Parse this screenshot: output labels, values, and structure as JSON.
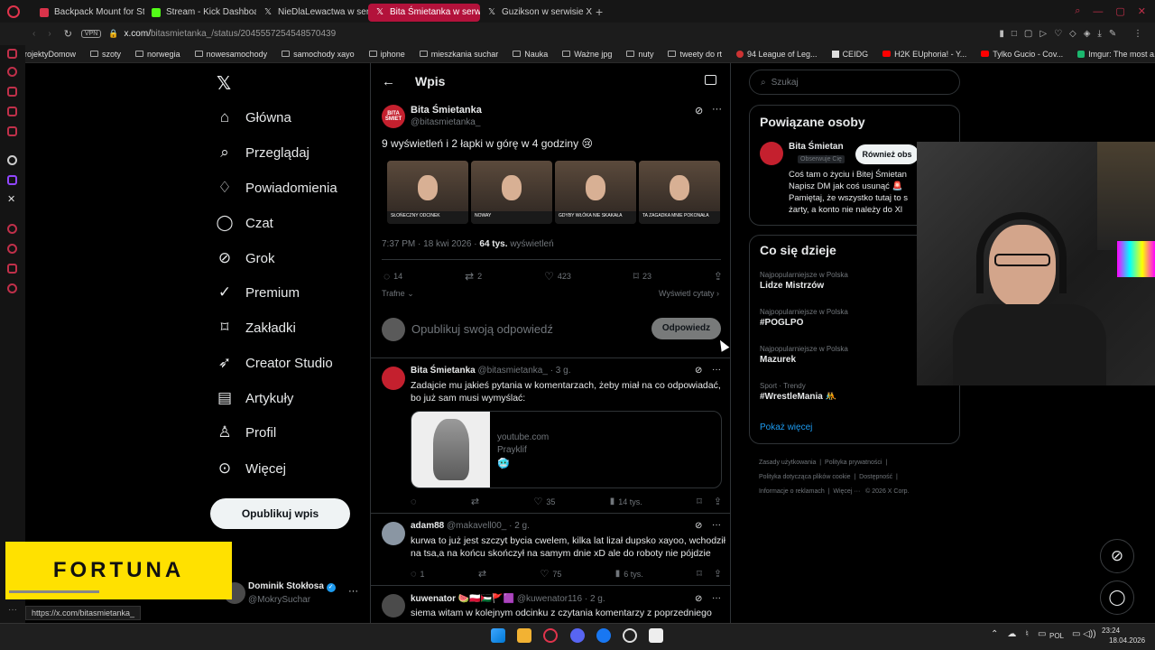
{
  "tabs": [
    {
      "label": "Backpack Mount for Starli",
      "icon": "red-icon"
    },
    {
      "label": "Stream - Kick Dashboard",
      "icon": "kick-icon"
    },
    {
      "label": "NieDlaLewactwa w serwis",
      "icon": "x-icon"
    },
    {
      "label": "Bita Śmietanka w serwisi",
      "icon": "x-icon",
      "active": true
    },
    {
      "label": "Guzikson w serwisie X: „",
      "icon": "x-icon"
    }
  ],
  "address": {
    "vpn": "VPN",
    "url_host": "x.com/",
    "url_path": "bitasmietanka_/status/2045557254548570439"
  },
  "bookmarks": [
    "ProjektyDomow",
    "szoty",
    "norwegia",
    "nowesamochody",
    "samochody xayo",
    "iphone",
    "mieszkania suchar",
    "Nauka",
    "Ważne jpg",
    "nuty",
    "tweety do rt",
    "94 League of Leg...",
    "CEIDG",
    "H2K EUphoria! - Y...",
    "Tylko Gucio - Cov...",
    "Imgur: The most a..."
  ],
  "nav": {
    "items": [
      {
        "label": "Główna",
        "icon": "home-icon"
      },
      {
        "label": "Przeglądaj",
        "icon": "search-icon"
      },
      {
        "label": "Powiadomienia",
        "icon": "bell-icon"
      },
      {
        "label": "Czat",
        "icon": "chat-icon"
      },
      {
        "label": "Grok",
        "icon": "grok-icon"
      },
      {
        "label": "Premium",
        "icon": "premium-icon"
      },
      {
        "label": "Zakładki",
        "icon": "bookmark-icon"
      },
      {
        "label": "Creator Studio",
        "icon": "rocket-icon"
      },
      {
        "label": "Artykuły",
        "icon": "article-icon"
      },
      {
        "label": "Profil",
        "icon": "person-icon"
      },
      {
        "label": "Więcej",
        "icon": "more-icon"
      }
    ],
    "post_button": "Opublikuj wpis",
    "account_name": "Dominik Stokłosa",
    "account_handle": "@MokrySuchar"
  },
  "post": {
    "header": "Wpis",
    "author": "Bita Śmietanka",
    "handle": "@bitasmietanka_",
    "avatar_text": "BITA ŚMIET",
    "text": "9 wyświetleń i 2 łapki w górę w 4 godziny 😢",
    "thumbs": [
      "SŁOŃECZNY ODCINEK",
      "NOWAY",
      "GDYBY WŁÓKA NIE SKAKAŁA",
      "TA ZAGADKA MNIE POKONAŁA"
    ],
    "time": "7:37 PM · 18 kwi 2026 ·",
    "views_count": "64 tys.",
    "views_label": "wyświetleń",
    "replies": "14",
    "reposts": "2",
    "likes": "423",
    "bookmarks": "23",
    "sort_label": "Trafne",
    "quotes_label": "Wyświetl cytaty",
    "reply_placeholder": "Opublikuj swoją odpowiedź",
    "reply_button": "Odpowiedz"
  },
  "replies": [
    {
      "author": "Bita Śmietanka",
      "handle": "@bitasmietanka_",
      "time": "· 3 g.",
      "text": "Zadajcie mu jakieś pytania w komentarzach, żeby miał na co odpowiadać, bo już sam musi wymyślać:",
      "card_domain": "youtube.com",
      "card_title": "Prayklif",
      "card_emoji": "🥶",
      "replies": "",
      "reposts": "",
      "likes": "35",
      "views": "14 tys."
    },
    {
      "author": "adam88",
      "handle": "@makavell00_",
      "time": "· 2 g.",
      "text": "kurwa to już jest szczyt bycia cwelem, kilka lat lizał dupsko xayoo, wchodził na tsa,a na końcu skończył na samym dnie xD ale do roboty nie pójdzie",
      "replies": "1",
      "reposts": "",
      "likes": "75",
      "views": "6 tys."
    },
    {
      "author": "kuwenator 🍉🇵🇱🇵🇸🚩🟪",
      "handle": "@kuwenator116",
      "time": "· 2 g.",
      "text": "siema witam w kolejnym odcinku z czytania komentarzy z poprzedniego"
    }
  ],
  "right": {
    "search_placeholder": "Szukaj",
    "related_title": "Powiązane osoby",
    "related_name": "Bita Śmietan",
    "related_badge": "Obserwuje Cię",
    "related_follow": "Również obs",
    "related_bio": "Coś tam o życiu i Bitej Śmietan Napisz DM jak coś usunąć 🚨 Pamiętaj, że wszystko tutaj to s żarty, a konto nie należy do Xl",
    "trends_title": "Co się dzieje",
    "trends": [
      {
        "meta": "Najpopularniejsze w Polska",
        "name": "Lidze Mistrzów"
      },
      {
        "meta": "Najpopularniejsze w Polska",
        "name": "#POGLPO"
      },
      {
        "meta": "Najpopularniejsze w Polska",
        "name": "Mazurek"
      },
      {
        "meta": "Sport · Trendy",
        "name": "#WrestleMania 🤼"
      }
    ],
    "show_more": "Pokaż więcej",
    "footer": [
      "Zasady użytkowania",
      "Polityka prywatności",
      "Polityka dotycząca plików cookie",
      "Dostępność",
      "Informacje o reklamach",
      "Więcej ···",
      "© 2026 X Corp."
    ]
  },
  "overlay": {
    "fortuna": "FORTUNA"
  },
  "status_url": "https://x.com/bitasmietanka_",
  "taskbar": {
    "lang": "POL",
    "time": "23:24",
    "date": "18.04.2026"
  },
  "colors": {
    "accent": "#1d9bf0",
    "tab_active": "#b3123b",
    "fortuna": "#ffe100"
  }
}
